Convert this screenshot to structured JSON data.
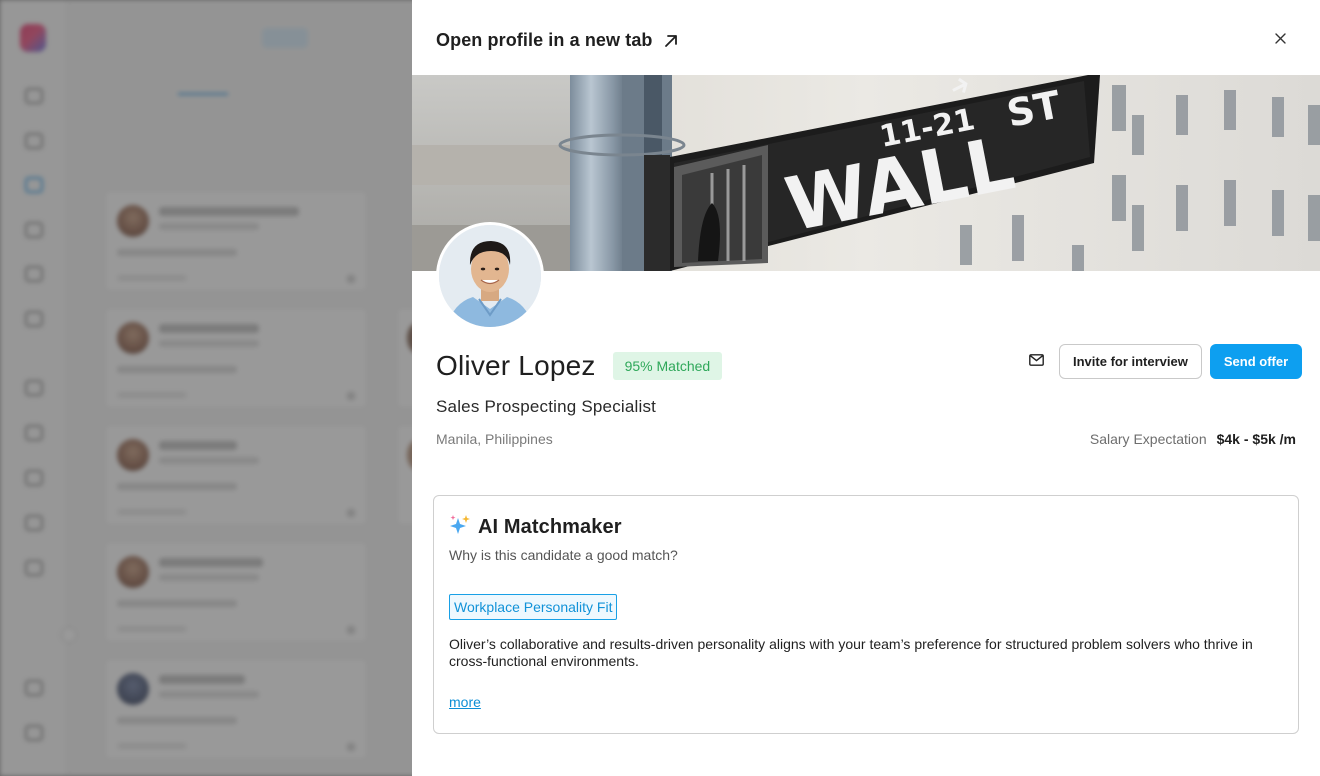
{
  "drawer": {
    "open_profile_label": "Open profile in a new tab",
    "close_icon": "close-icon",
    "external_link_icon": "arrow-up-right-icon"
  },
  "cover": {
    "street_sign_number": "11-21",
    "street_sign_name": "WALL",
    "street_sign_suffix": "ST"
  },
  "candidate": {
    "name": "Oliver Lopez",
    "match_badge": "95% Matched",
    "title": "Sales Prospecting Specialist",
    "location": "Manila, Philippines",
    "salary_label": "Salary Expectation",
    "salary_value": "$4k - $5k /m"
  },
  "actions": {
    "mail_icon": "mail-icon",
    "invite_label": "Invite for interview",
    "offer_label": "Send offer"
  },
  "matchmaker": {
    "icon": "sparkles-icon",
    "title": "AI Matchmaker",
    "subtitle": "Why is this candidate a good match?",
    "tag": "Workplace Personality Fit",
    "body": "Oliver’s collaborative and results-driven personality aligns with your team’s preference for structured problem solvers who thrive in cross-functional environments.",
    "more_label": "more"
  },
  "colors": {
    "accent": "#0d9ff0",
    "match_green": "#2fa85a",
    "match_green_bg": "#dff5e6",
    "overlay": "rgba(70,70,70,0.55)"
  }
}
